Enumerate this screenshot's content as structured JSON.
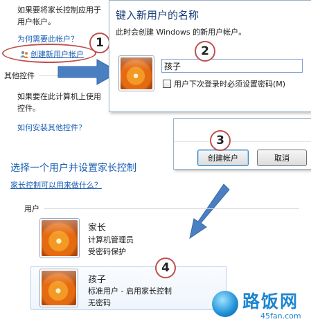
{
  "left_panel": {
    "text1_line1": "如果要将家长控制应用于",
    "text1_line2": "用户帐户。",
    "why_link": "为何需要此帐户？",
    "create_link": "创建新用户帐户",
    "other_controls_heading": "其他控件",
    "text2_line1": "如果要在此计算机上使用",
    "text2_line2": "控件。",
    "install_link": "如何安装其他控件？"
  },
  "dialog_name": {
    "title": "键入新用户的名称",
    "subtitle": "此时会创建 Windows 的新用户帐户。",
    "name_value": "孩子",
    "checkbox_label": "用户下次登录时必须设置密码(M)",
    "checkbox_checked": false
  },
  "dialog_buttons": {
    "create_label": "创建帐户",
    "cancel_label": "取消"
  },
  "parental": {
    "heading": "选择一个用户并设置家长控制",
    "what_link": "家长控制可以用来做什么？",
    "users_label": "用户",
    "users": [
      {
        "name": "家长",
        "line1": "计算机管理员",
        "line2": "受密码保护"
      },
      {
        "name": "孩子",
        "line1": "标准用户 - 启用家长控制",
        "line2": "无密码"
      }
    ]
  },
  "steps": [
    "1",
    "2",
    "3",
    "4"
  ],
  "watermark": {
    "brand": "路饭网",
    "url": "45fan.com"
  },
  "colors": {
    "link": "#1a5fb4",
    "heading": "#1a5fb4",
    "step_ring": "#c0504d",
    "arrow": "#4a7fc1"
  }
}
